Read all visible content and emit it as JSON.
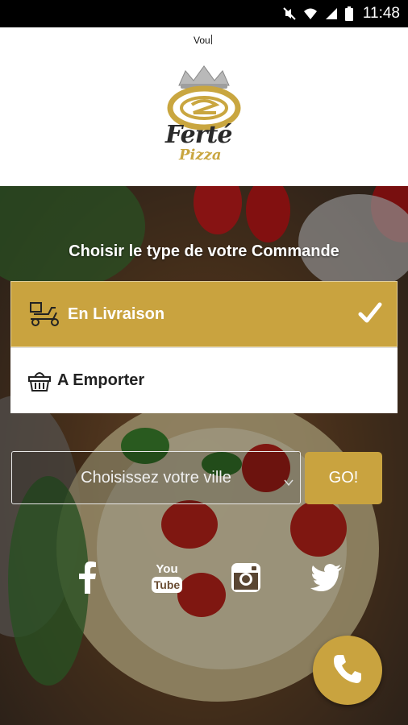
{
  "status_bar": {
    "time": "11:48"
  },
  "header": {
    "text": "Vou"
  },
  "logo": {
    "word1": "Ferté",
    "word2": "Pizza"
  },
  "order": {
    "title": "Choisir le type de votre Commande",
    "options": [
      {
        "label": "En Livraison",
        "selected": true,
        "icon": "delivery-scooter-icon"
      },
      {
        "label": "A Emporter",
        "selected": false,
        "icon": "basket-icon"
      }
    ]
  },
  "city": {
    "placeholder": "Choisissez votre ville"
  },
  "go": {
    "label": "GO!"
  },
  "social": [
    "facebook-icon",
    "youtube-icon",
    "instagram-icon",
    "twitter-icon"
  ],
  "colors": {
    "gold": "#c9a33f",
    "status_bar": "#000000",
    "white": "#ffffff"
  }
}
